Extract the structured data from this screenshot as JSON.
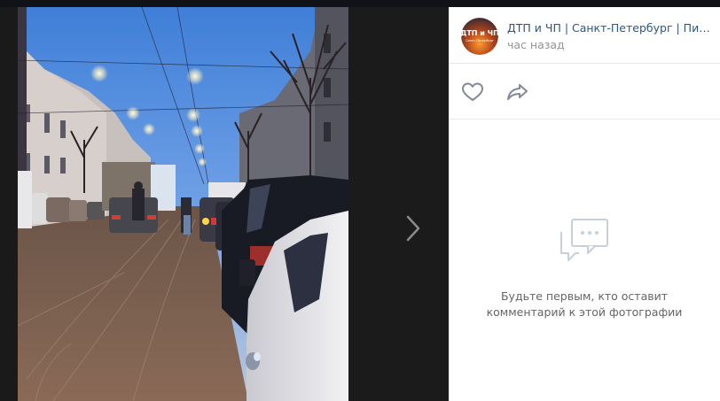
{
  "header": {
    "group_name": "ДТП и ЧП | Санкт-Петербург | Питер онлайн | СПб",
    "time": "час назад",
    "avatar_text_line1": "ДТП и ЧП",
    "avatar_text_line2": "Санкт-Петербург"
  },
  "actions": {
    "like_icon": "heart-icon",
    "share_icon": "share-arrow-icon"
  },
  "comments": {
    "empty_line1": "Будьте первым, кто оставит",
    "empty_line2": "комментарий к этой фотографии",
    "empty_icon": "chat-bubbles-icon"
  },
  "viewer": {
    "next_icon": "chevron-right-icon"
  }
}
